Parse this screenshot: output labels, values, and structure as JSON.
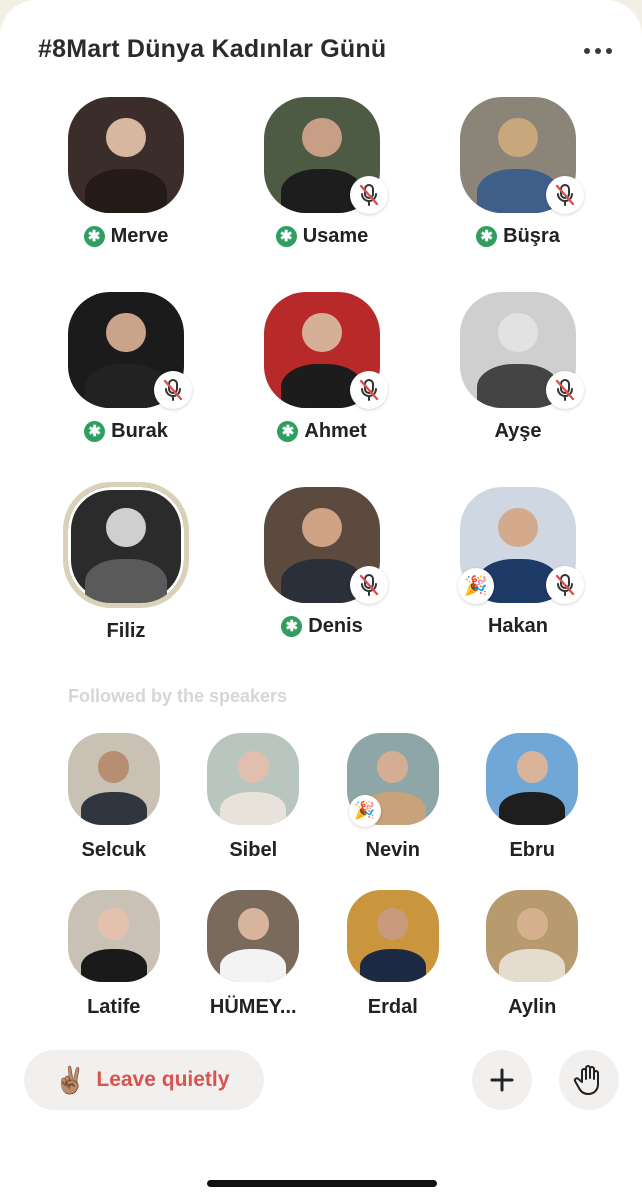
{
  "room": {
    "title": "#8Mart Dünya Kadınlar Günü",
    "more_icon": "more-horizontal-icon"
  },
  "speakers": [
    {
      "name": "Merve",
      "moderator": true,
      "muted": false,
      "party": false,
      "ring": false,
      "bg": "#3a2d2a",
      "face": "#d8b7a0",
      "body": "#241a18"
    },
    {
      "name": "Usame",
      "moderator": true,
      "muted": true,
      "party": false,
      "ring": false,
      "bg": "#4d5a44",
      "face": "#c89f84",
      "body": "#1d1d1d"
    },
    {
      "name": "Büşra",
      "moderator": true,
      "muted": true,
      "party": false,
      "ring": false,
      "bg": "#8a8578",
      "face": "#c9a77c",
      "body": "#3e5f8a"
    },
    {
      "name": "Burak",
      "moderator": true,
      "muted": true,
      "party": false,
      "ring": false,
      "bg": "#1b1b1b",
      "face": "#c9a38a",
      "body": "#222222"
    },
    {
      "name": "Ahmet",
      "moderator": true,
      "muted": true,
      "party": false,
      "ring": false,
      "bg": "#b82a2a",
      "face": "#d6b096",
      "body": "#1c1c1c"
    },
    {
      "name": "Ayşe",
      "moderator": false,
      "muted": true,
      "party": false,
      "ring": false,
      "bg": "#cfcfcf",
      "face": "#e2e2e2",
      "body": "#444444"
    },
    {
      "name": "Filiz",
      "moderator": false,
      "muted": false,
      "party": false,
      "ring": true,
      "bg": "#2b2b2b",
      "face": "#cfcfcf",
      "body": "#5a5a5a"
    },
    {
      "name": "Denis",
      "moderator": true,
      "muted": true,
      "party": false,
      "ring": false,
      "bg": "#5c4a3e",
      "face": "#cda285",
      "body": "#2a2f3a"
    },
    {
      "name": "Hakan",
      "moderator": false,
      "muted": true,
      "party": true,
      "ring": false,
      "bg": "#cfd8e2",
      "face": "#d4a98c",
      "body": "#1e3a66"
    }
  ],
  "section": {
    "followed_label": "Followed by the speakers"
  },
  "listeners": [
    {
      "name": "Selcuk",
      "party": false,
      "bg": "#c9c1b4",
      "face": "#b88e72",
      "body": "#2f3640"
    },
    {
      "name": "Sibel",
      "party": false,
      "bg": "#b9c6c0",
      "face": "#e0bfae",
      "body": "#e7e2da"
    },
    {
      "name": "Nevin",
      "party": true,
      "bg": "#8ea6a8",
      "face": "#d5ad92",
      "body": "#c8a27a"
    },
    {
      "name": "Ebru",
      "party": false,
      "bg": "#6fa7d6",
      "face": "#d9b49a",
      "body": "#1e1e1e"
    },
    {
      "name": "Latife",
      "party": false,
      "bg": "#c9c0b6",
      "face": "#e2c1ad",
      "body": "#1a1a1a"
    },
    {
      "name": "HÜMEY...",
      "party": false,
      "bg": "#7a6a5c",
      "face": "#d8b49c",
      "body": "#f3f3f3"
    },
    {
      "name": "Erdal",
      "party": false,
      "bg": "#c9963e",
      "face": "#c99a7e",
      "body": "#1d2a44"
    },
    {
      "name": "Aylin",
      "party": false,
      "bg": "#b79a6e",
      "face": "#d6b18e",
      "body": "#e5dccf"
    }
  ],
  "actions": {
    "leave_label": "Leave quietly",
    "leave_icon": "victory-hand-icon",
    "leave_glyph": "✌🏽",
    "add_icon": "plus-icon",
    "hand_icon": "raise-hand-icon",
    "party_glyph": "🎉"
  },
  "colors": {
    "moderator_badge": "#2f9e5f",
    "leave_text": "#d9534f",
    "muted_icon": "#d9534f"
  }
}
